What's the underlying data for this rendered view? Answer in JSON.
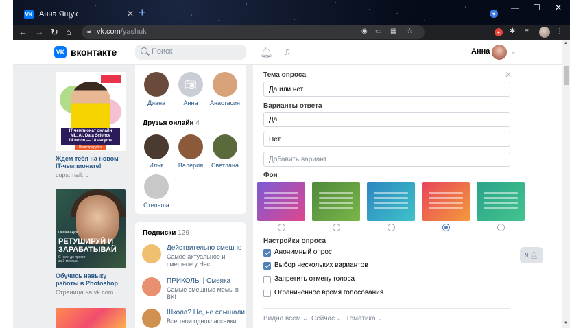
{
  "browser": {
    "tab_title": "Анна Ящук",
    "url_host": "vk.com",
    "url_path": "/yashuk"
  },
  "header": {
    "logo_text": "вконтакте",
    "search_placeholder": "Поиск",
    "user_name": "Анна"
  },
  "ads": [
    {
      "headline_line1": "IT-чемпионат онлайн",
      "headline_line2": "ML, AI, Data Science",
      "dates": "14 июля — 18 августа",
      "cta": "Регистрируйся",
      "title": "Ждем тебя на новом IT-чемпионате!",
      "domain": "cups.mail.ru"
    },
    {
      "tag": "Онлайн-курс",
      "headline": "РЕТУШИРУЙ И ЗАРАБАТЫВАЙ",
      "sub": "С нуля до профи за 3 месяца",
      "title": "Обучись навыку работы в Photoshop",
      "domain": "Страница на vk.com"
    }
  ],
  "friends": {
    "top": [
      {
        "name": "Диана",
        "color": "#6a4a3a"
      },
      {
        "name": "Анна",
        "color": "#c9ced6"
      },
      {
        "name": "Анастасия",
        "color": "#d8a27a"
      }
    ],
    "online_title": "Друзья онлайн",
    "online_count": "4",
    "online": [
      {
        "name": "Илья",
        "color": "#4a3a30"
      },
      {
        "name": "Валерия",
        "color": "#8a5a3a"
      },
      {
        "name": "Светлана",
        "color": "#5a6a3a"
      },
      {
        "name": "Степаша",
        "color": "#c8c8c8"
      }
    ]
  },
  "subscriptions": {
    "title": "Подписки",
    "count": "129",
    "items": [
      {
        "name": "Действительно смешно",
        "desc": "Самое актуальное и смешное у Нас!",
        "color": "#f0c070"
      },
      {
        "name": "ПРИКОЛЫ | Смеяка",
        "desc": "Самые смешные мемы в ВК!",
        "color": "#e89070"
      },
      {
        "name": "Школа? Не, не слышали",
        "desc": "Все твои одноклассники",
        "color": "#d09050"
      }
    ]
  },
  "poll": {
    "topic_label": "Тема опроса",
    "topic_value": "Да или нет",
    "options_label": "Варианты ответа",
    "options": [
      "Да",
      "Нет"
    ],
    "add_option_placeholder": "Добавить вариант",
    "background_label": "Фон",
    "backgrounds": [
      {
        "from": "#7a5bd6",
        "to": "#e0468c",
        "selected": false
      },
      {
        "from": "#4e8a3c",
        "to": "#7ab648",
        "selected": false
      },
      {
        "from": "#2e86c1",
        "to": "#3ec2c8",
        "selected": false
      },
      {
        "from": "#e8455a",
        "to": "#f39a3c",
        "selected": true
      },
      {
        "from": "#2ba38a",
        "to": "#43c48e",
        "selected": false
      }
    ],
    "settings_label": "Настройки опроса",
    "settings": [
      {
        "label": "Анонимный опрос",
        "checked": true
      },
      {
        "label": "Выбор нескольких вариантов",
        "checked": true
      },
      {
        "label": "Запретить отмену голоса",
        "checked": false
      },
      {
        "label": "Ограниченное время голосования",
        "checked": false
      }
    ],
    "footer": [
      "Видно всем",
      "Сейчас",
      "Тематика"
    ]
  },
  "chat_badge": "9"
}
